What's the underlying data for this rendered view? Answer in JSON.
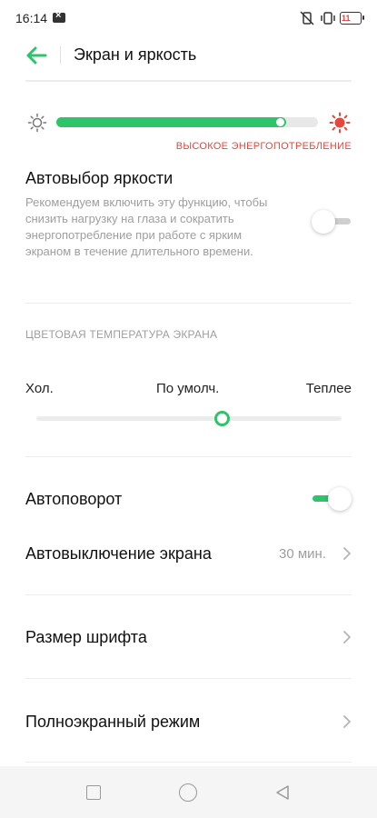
{
  "status_bar": {
    "time": "16:14",
    "battery_level": "11"
  },
  "header": {
    "title": "Экран и яркость"
  },
  "brightness": {
    "level": 0.88,
    "warning": "ВЫСОКОЕ ЭНЕРГОПОТРЕБЛЕНИЕ"
  },
  "auto_brightness": {
    "title": "Автовыбор яркости",
    "description": "Рекомендуем включить эту функцию, чтобы снизить нагрузку на глаза и сократить энергопотребление при работе с ярким экраном в течение длительного времени.",
    "enabled": false
  },
  "color_temperature": {
    "section_label": "ЦВЕТОВАЯ ТЕМПЕРАТУРА ЭКРАНА",
    "cold_label": "Хол.",
    "default_label": "По умолч.",
    "warm_label": "Теплее",
    "value": 0.61
  },
  "settings": {
    "auto_rotate": {
      "label": "Автоповорот",
      "enabled": true
    },
    "screen_timeout": {
      "label": "Автовыключение экрана",
      "value": "30 мин."
    },
    "font_size": {
      "label": "Размер шрифта"
    },
    "fullscreen_mode": {
      "label": "Полноэкранный режим"
    }
  },
  "colors": {
    "accent": "#2ec46b",
    "warning": "#e8463c"
  }
}
